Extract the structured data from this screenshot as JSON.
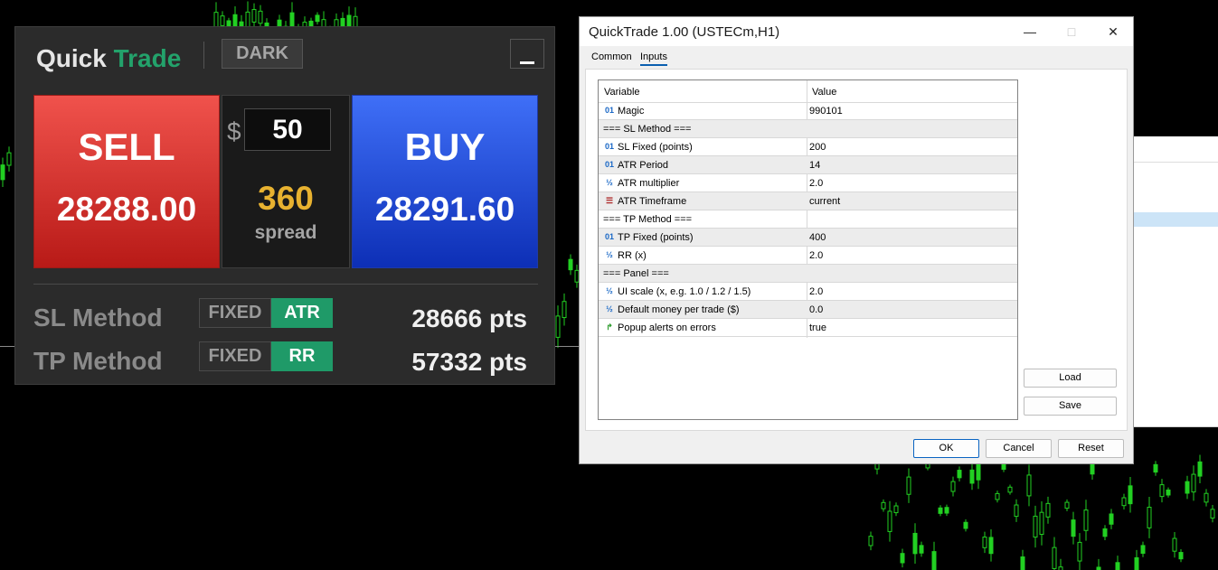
{
  "panel": {
    "title_main": "Quick",
    "title_accent": "Trade",
    "theme_button": "DARK",
    "minimize_label": "_",
    "sell_label": "SELL",
    "sell_price": "28288.00",
    "buy_label": "BUY",
    "buy_price": "28291.60",
    "currency_symbol": "$",
    "amount": "50",
    "spread_value": "360",
    "spread_label": "spread",
    "sl_label": "SL Method",
    "tp_label": "TP Method",
    "sl_options": [
      "FIXED",
      "ATR"
    ],
    "sl_selected": "ATR",
    "tp_options": [
      "FIXED",
      "RR"
    ],
    "tp_selected": "RR",
    "sl_points": "28666 pts",
    "tp_points": "57332 pts",
    "colors": {
      "accent": "#23a26b",
      "sell": "#d8302c",
      "buy": "#2a55e8",
      "spread": "#e8b230"
    }
  },
  "dialog": {
    "title": "QuickTrade 1.00 (USTECm,H1)",
    "window_controls": [
      "minimize-icon",
      "maximize-icon",
      "close-icon"
    ],
    "tabs": [
      "Common",
      "Inputs"
    ],
    "active_tab": "Inputs",
    "columns": [
      "Variable",
      "Value"
    ],
    "rows": [
      {
        "icon": "int-icon",
        "glyph": "01",
        "name": "Magic",
        "value": "990101",
        "section": false
      },
      {
        "icon": "",
        "glyph": "",
        "name": "=== SL Method ===",
        "value": "",
        "section": true
      },
      {
        "icon": "int-icon",
        "glyph": "01",
        "name": "SL Fixed (points)",
        "value": "200",
        "section": false
      },
      {
        "icon": "int-icon",
        "glyph": "01",
        "name": "ATR Period",
        "value": "14",
        "section": false
      },
      {
        "icon": "double-icon",
        "glyph": "½",
        "name": "ATR multiplier",
        "value": "2.0",
        "section": false
      },
      {
        "icon": "enum-icon",
        "glyph": "☰",
        "name": "ATR Timeframe",
        "value": "current",
        "section": false
      },
      {
        "icon": "",
        "glyph": "",
        "name": "=== TP Method ===",
        "value": "",
        "section": true
      },
      {
        "icon": "int-icon",
        "glyph": "01",
        "name": "TP Fixed (points)",
        "value": "400",
        "section": false
      },
      {
        "icon": "double-icon",
        "glyph": "½",
        "name": "RR (x)",
        "value": "2.0",
        "section": false
      },
      {
        "icon": "",
        "glyph": "",
        "name": "=== Panel ===",
        "value": "",
        "section": true
      },
      {
        "icon": "double-icon",
        "glyph": "½",
        "name": "UI scale (x, e.g. 1.0 / 1.2 / 1.5)",
        "value": "2.0",
        "section": false
      },
      {
        "icon": "double-icon",
        "glyph": "½",
        "name": "Default money per trade ($)",
        "value": "0.0",
        "section": false
      },
      {
        "icon": "bool-icon",
        "glyph": "↱",
        "name": "Popup alerts on errors",
        "value": "true",
        "section": false
      }
    ],
    "side_buttons": [
      "Load",
      "Save"
    ],
    "bottom_buttons": [
      "OK",
      "Cancel",
      "Reset"
    ]
  }
}
